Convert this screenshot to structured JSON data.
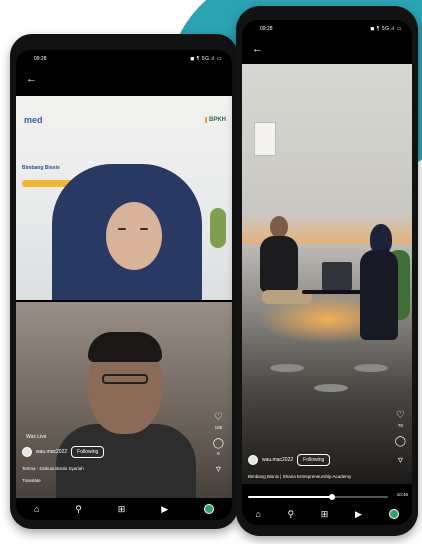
{
  "left_phone": {
    "status_time": "09:28",
    "status_icons": "◼ ¶ 5G.ıl ▭",
    "logos": {
      "left": "med",
      "right": "BPKH"
    },
    "banner_title": "Bimbang Bisnis",
    "live_label": "Wax Live",
    "username": "wau.mac2022",
    "follow_label": "Following",
    "caption": "Terima · Diskusi Bisnis Syariah",
    "translate_label": "Translate",
    "like_count": "106",
    "comment_count": "0",
    "time_right": "09:00",
    "progress_percent": 68,
    "nav_icons": [
      "home-icon",
      "search-icon",
      "add-icon",
      "reels-icon",
      "profile-avatar"
    ]
  },
  "right_phone": {
    "status_time": "09:28",
    "status_icons": "◼ ¶ 5G.ıl ▭",
    "username": "wau.mac2022",
    "follow_label": "Following",
    "caption": "Bimbang Bisnis | Sharia Entrepreneurship Academy",
    "like_count": "78",
    "time_right": "10:46",
    "progress_percent": 60
  }
}
